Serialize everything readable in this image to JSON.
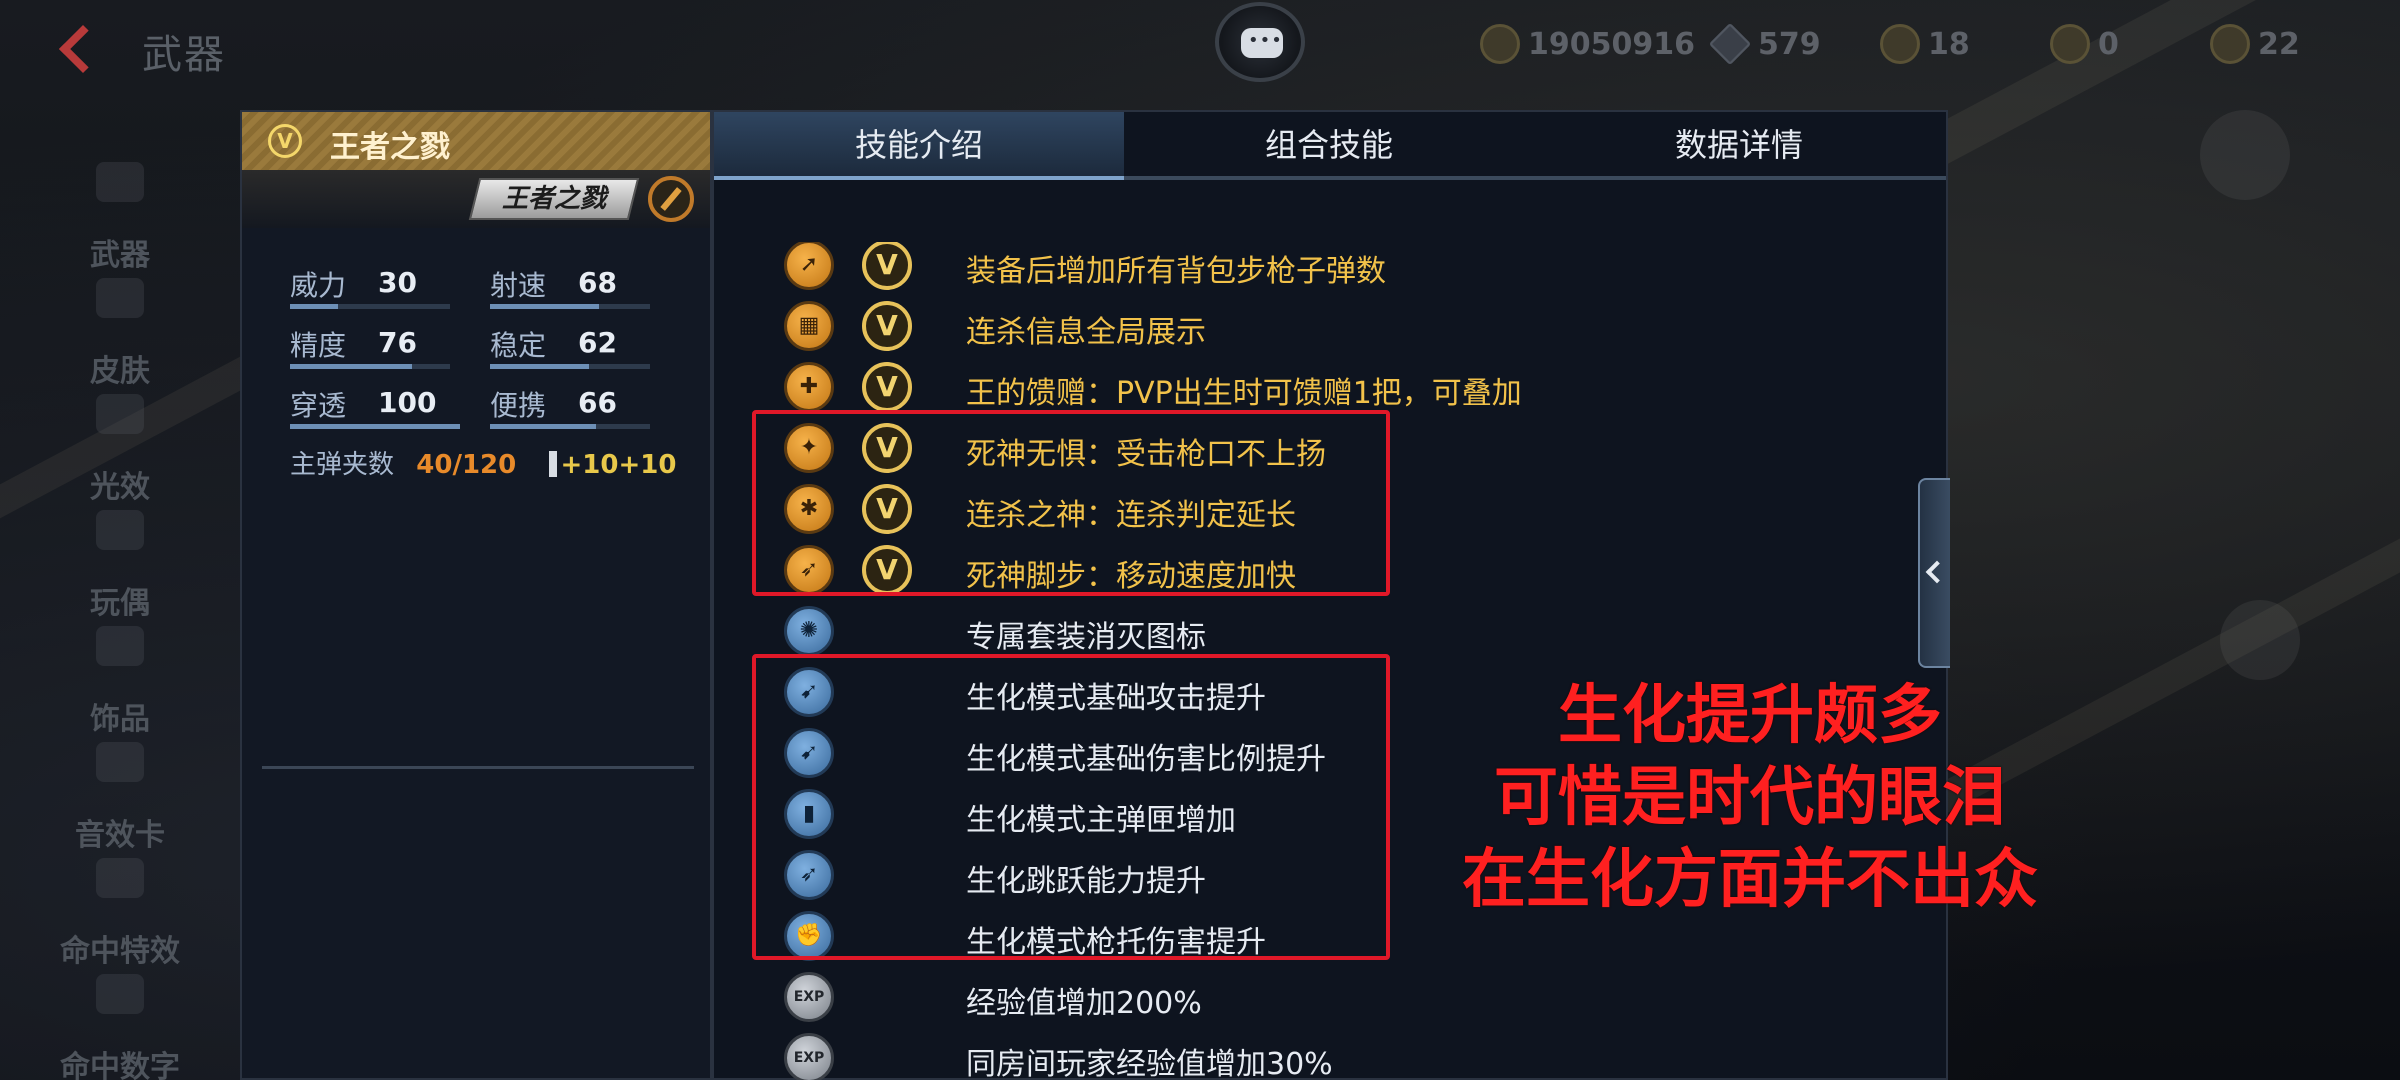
{
  "topbar": {
    "title": "武器",
    "currencies": [
      {
        "icon": "gold-coin-icon",
        "value": "19050916"
      },
      {
        "icon": "diamond-icon",
        "value": "579"
      },
      {
        "icon": "ticket-icon",
        "value": "18"
      },
      {
        "icon": "token-icon",
        "value": "0"
      },
      {
        "icon": "crystal-icon",
        "value": "22"
      }
    ]
  },
  "leftnav": {
    "items": [
      "武器",
      "皮肤",
      "光效",
      "玩偶",
      "饰品",
      "音效卡",
      "命中特效",
      "命中数字"
    ]
  },
  "weapon": {
    "badge": "V",
    "name": "王者之戮",
    "logo_text": "王者之戮",
    "stats": [
      {
        "label": "威力",
        "value": "30",
        "level": 0.3
      },
      {
        "label": "射速",
        "value": "68",
        "level": 0.68
      },
      {
        "label": "精度",
        "value": "76",
        "level": 0.76
      },
      {
        "label": "稳定",
        "value": "62",
        "level": 0.62
      },
      {
        "label": "穿透",
        "value": "100",
        "level": 1.0
      },
      {
        "label": "便携",
        "value": "66",
        "level": 0.66
      }
    ],
    "ammo_label": "主弹夹数",
    "ammo_value": "40/120",
    "ammo_bonus": "+10+10"
  },
  "tabs": [
    "技能介绍",
    "组合技能",
    "数据详情"
  ],
  "skills": [
    {
      "icon": "rifle-ammo-icon",
      "glyph": "➚",
      "style": "orange",
      "vip": true,
      "text": "装备后增加所有背包步枪子弹数",
      "color": "gold"
    },
    {
      "icon": "kill-info-icon",
      "glyph": "▦",
      "style": "orange",
      "vip": true,
      "text": "连杀信息全局展示",
      "color": "gold"
    },
    {
      "icon": "gift-icon",
      "glyph": "✚",
      "style": "orange",
      "vip": true,
      "text": "王的馈赠：PVP出生时可馈赠1把，可叠加",
      "color": "gold"
    },
    {
      "icon": "recoil-icon",
      "glyph": "✦",
      "style": "orange",
      "vip": true,
      "text": "死神无惧：受击枪口不上扬",
      "color": "gold"
    },
    {
      "icon": "killstreak-icon",
      "glyph": "✱",
      "style": "orange",
      "vip": true,
      "text": "连杀之神：连杀判定延长",
      "color": "gold"
    },
    {
      "icon": "running-man-icon",
      "glyph": "➶",
      "style": "orange",
      "vip": true,
      "text": "死神脚步：移动速度加快",
      "color": "gold"
    },
    {
      "icon": "eliminate-icon",
      "glyph": "✺",
      "style": "blue",
      "vip": false,
      "text": "专属套装消灭图标",
      "color": "white"
    },
    {
      "icon": "zombie-attack-icon",
      "glyph": "➹",
      "style": "blue",
      "vip": false,
      "text": "生化模式基础攻击提升",
      "color": "white"
    },
    {
      "icon": "zombie-damage-icon",
      "glyph": "➹",
      "style": "blue",
      "vip": false,
      "text": "生化模式基础伤害比例提升",
      "color": "white"
    },
    {
      "icon": "zombie-magazine-icon",
      "glyph": "▮",
      "style": "blue",
      "vip": false,
      "text": "生化模式主弹匣增加",
      "color": "white"
    },
    {
      "icon": "zombie-jump-icon",
      "glyph": "➶",
      "style": "blue",
      "vip": false,
      "text": "生化跳跃能力提升",
      "color": "white"
    },
    {
      "icon": "zombie-stock-icon",
      "glyph": "✊",
      "style": "blue",
      "vip": false,
      "text": "生化模式枪托伤害提升",
      "color": "white"
    },
    {
      "icon": "exp-icon",
      "glyph": "EXP",
      "style": "grey",
      "vip": false,
      "text": "经验值增加200%",
      "color": "white"
    },
    {
      "icon": "room-exp-icon",
      "glyph": "EXP",
      "style": "grey",
      "vip": false,
      "text": "同房间玩家经验值增加30%",
      "color": "white"
    }
  ],
  "overlay": {
    "lines": [
      "生化提升颇多",
      "可惜是时代的眼泪",
      "在生化方面并不出众"
    ]
  },
  "colors": {
    "highlight_box": "#e01828",
    "gold_text": "#f2c24a",
    "overlay_text": "#ff2020"
  }
}
